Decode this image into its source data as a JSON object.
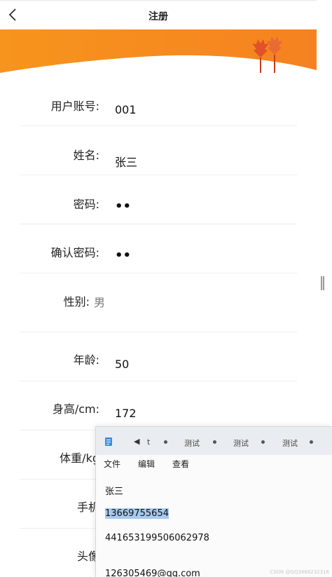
{
  "navbar": {
    "title": "注册"
  },
  "form": {
    "rows": [
      {
        "label": "用户账号:",
        "value": "001"
      },
      {
        "label": "姓名:",
        "value": "张三"
      },
      {
        "label": "密码:",
        "value": "••"
      },
      {
        "label": "确认密码:",
        "value": "••"
      },
      {
        "label": "性别:",
        "value": "男"
      },
      {
        "label": "年龄:",
        "value": "50"
      },
      {
        "label": "身高/cm:",
        "value": "172"
      },
      {
        "label": "体重/kg",
        "value": ""
      },
      {
        "label": "手机",
        "value": ""
      },
      {
        "label": "头像",
        "value": ""
      }
    ]
  },
  "notepad": {
    "tabs": [
      "t",
      "测试",
      "测试",
      "测试"
    ],
    "menu": [
      "文件",
      "编辑",
      "查看"
    ],
    "lines": [
      "张三",
      "13669755654",
      "441653199506062978",
      "",
      "126305469@qq.com"
    ]
  },
  "watermark": "CSDN @QQ3868232316",
  "colors": {
    "banner_orange": "#f7941d",
    "selection": "#a6c9ee"
  }
}
